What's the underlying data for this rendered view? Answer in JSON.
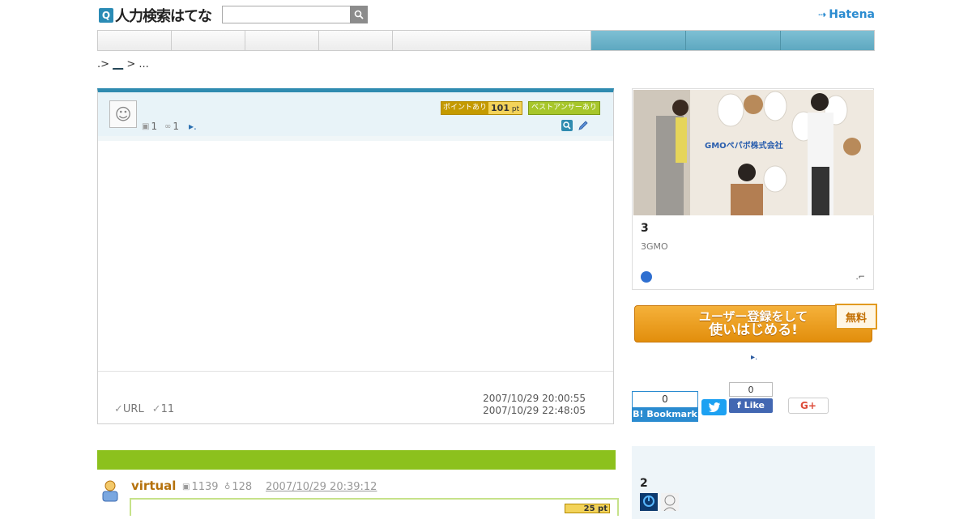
{
  "header": {
    "logo_text": "人力検索はてな",
    "search_placeholder": "",
    "brand": "Hatena"
  },
  "gnav": {
    "items": [
      "",
      "",
      "",
      "",
      "",
      "",
      "",
      ""
    ]
  },
  "breadcrumb": {
    "sep1": ".>",
    "link": "__",
    "sep2": "> ..."
  },
  "question": {
    "stats": {
      "questions": "1",
      "answers": "1",
      "more": "▸."
    },
    "point_badge": {
      "label": "ポイントあり",
      "value": "101",
      "unit": "pt"
    },
    "best_badge": "ベストアンサーあり",
    "meta": {
      "url_label": "URL",
      "check_count": "11"
    },
    "dates": {
      "created": "2007/10/29 20:00:55",
      "closed": "2007/10/29 22:48:05"
    }
  },
  "answer": {
    "user": "virtual",
    "answers_count": "1139",
    "best_count": "128",
    "date": "2007/10/29 20:39:12",
    "points": "25 pt"
  },
  "ad": {
    "photo_sign": "GMOペパボ株式会社",
    "title": "3",
    "subtitle": "3GMO",
    "corner": ".⌐"
  },
  "register": {
    "line1": "ユーザー登録をして",
    "line2": "使いはじめる!",
    "free": "無料",
    "link": "▸."
  },
  "social": {
    "hatena_count": "0",
    "hatena_label": "B! Bookmark",
    "fb_count": "0",
    "fb_label": "Like",
    "gplus_label": "G+"
  },
  "side_panel": {
    "title": "2"
  },
  "colors": {
    "accent_blue": "#2f8bb0",
    "answer_green": "#8cc11d",
    "register_orange": "#e28e0c"
  }
}
